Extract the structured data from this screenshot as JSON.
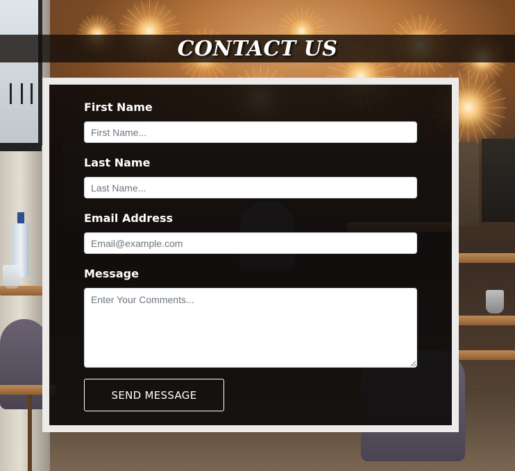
{
  "page": {
    "title": "CONTACT US"
  },
  "form": {
    "first_name": {
      "label": "First Name",
      "placeholder": "First Name...",
      "value": ""
    },
    "last_name": {
      "label": "Last Name",
      "placeholder": "Last Name...",
      "value": ""
    },
    "email": {
      "label": "Email Address",
      "placeholder": "Email@example.com",
      "value": ""
    },
    "message": {
      "label": "Message",
      "placeholder": "Enter Your Comments...",
      "value": ""
    },
    "submit_label": "SEND MESSAGE"
  },
  "colors": {
    "card_border": "#ecebea",
    "card_background": "#0c0a0a",
    "title_text": "#ffffff",
    "button_border": "#ffffff"
  }
}
